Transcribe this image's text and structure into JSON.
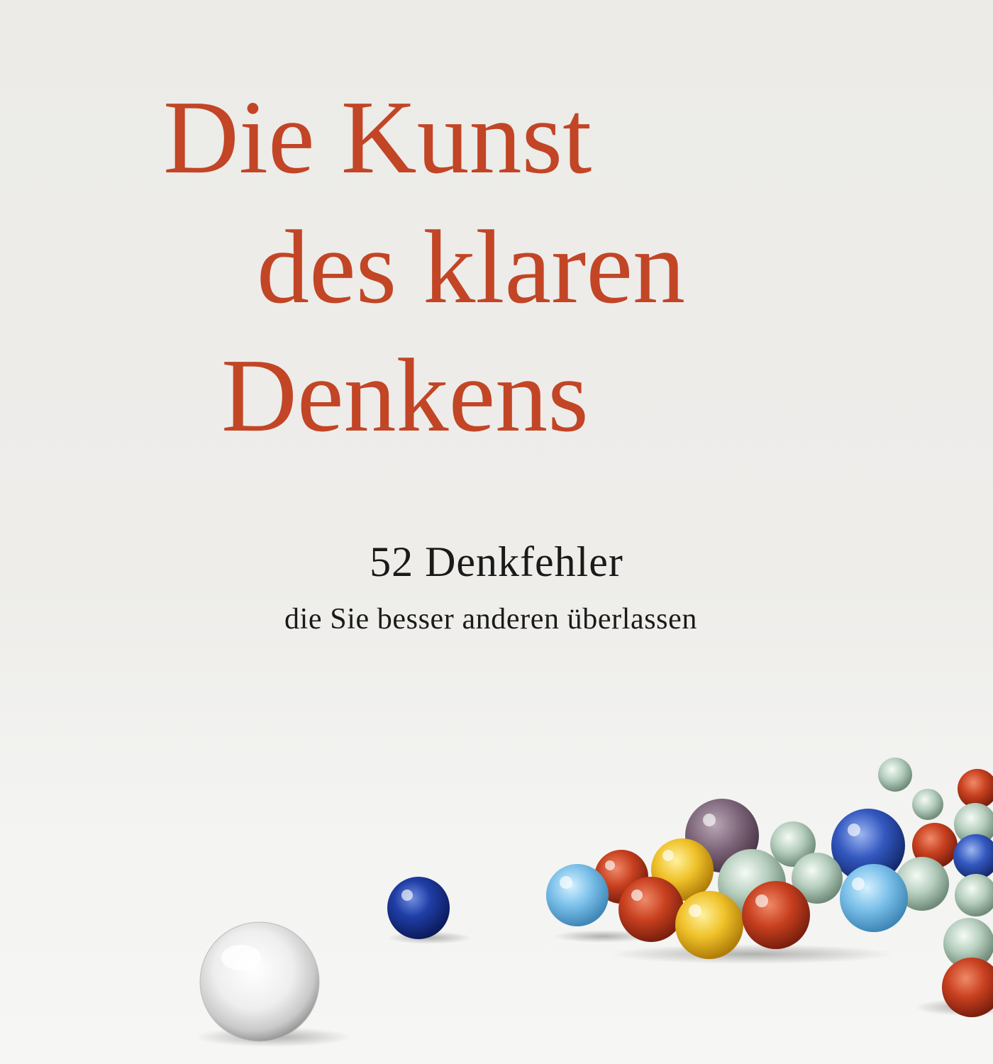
{
  "cover": {
    "title_lines": [
      "Die Kunst",
      "des klaren",
      "Denkens"
    ],
    "subtitle": "52 Denkfehler",
    "tagline": "die Sie besser anderen überlassen"
  },
  "colors": {
    "title": "#c24526",
    "subtitle": "#1a1a1a",
    "background": "#eeedea"
  },
  "illustration": {
    "subject": "glass marbles",
    "marble_colors": [
      "clear",
      "dark-blue",
      "light-blue",
      "red",
      "yellow",
      "purple",
      "green",
      "orange"
    ]
  }
}
